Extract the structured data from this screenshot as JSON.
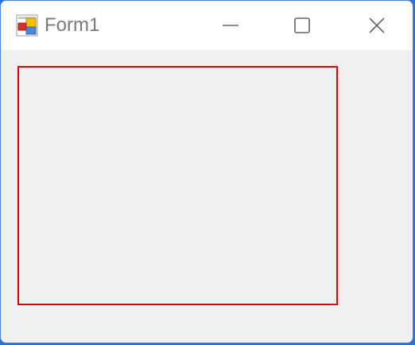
{
  "window": {
    "title": "Form1",
    "app_icon": "winforms-app-icon",
    "controls": {
      "minimize_icon": "minimize-icon",
      "maximize_icon": "maximize-icon",
      "close_icon": "close-icon"
    }
  },
  "client": {
    "panel_border_color": "#e00000",
    "background_color": "#f0f0f0"
  }
}
